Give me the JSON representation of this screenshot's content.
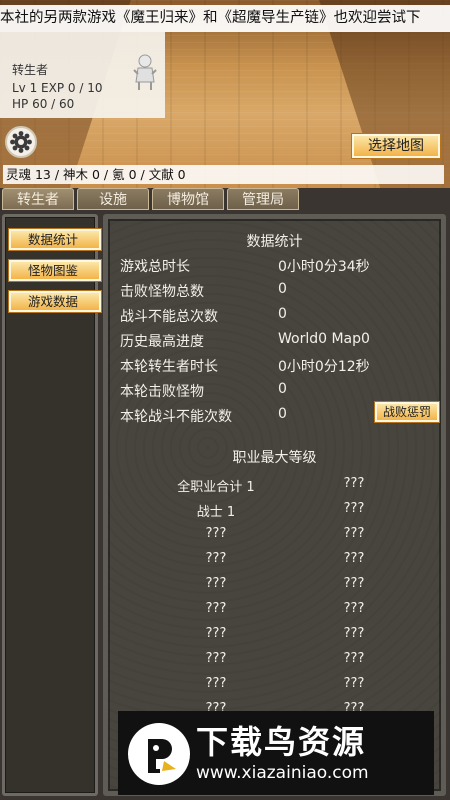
{
  "ticker": "本社的另两款游戏《魔王归来》和《超魔导生产链》也欢迎尝试下",
  "character": {
    "name": "转生者",
    "level_exp": "Lv 1 EXP 0 / 10",
    "hp": "HP 60 / 60"
  },
  "buttons": {
    "select_map": "选择地图",
    "fail_penalty": "战败惩罚"
  },
  "resources": "灵魂 13 / 神木 0 / 氪 0 / 文献 0",
  "tabs": [
    {
      "label": "转生者"
    },
    {
      "label": "设施"
    },
    {
      "label": "博物馆"
    },
    {
      "label": "管理局"
    }
  ],
  "sidebar": [
    {
      "label": "数据统计"
    },
    {
      "label": "怪物图鉴"
    },
    {
      "label": "游戏数据"
    }
  ],
  "stats": {
    "title": "数据统计",
    "rows": [
      {
        "label": "游戏总时长",
        "value": "0小时0分34秒"
      },
      {
        "label": "击败怪物总数",
        "value": "0"
      },
      {
        "label": "战斗不能总次数",
        "value": "0"
      },
      {
        "label": "历史最高进度",
        "value": "World0 Map0"
      },
      {
        "label": "本轮转生者时长",
        "value": "0小时0分12秒"
      },
      {
        "label": "本轮击败怪物",
        "value": "0"
      },
      {
        "label": "本轮战斗不能次数",
        "value": "0"
      }
    ]
  },
  "jobs": {
    "title": "职业最大等级",
    "rows": [
      {
        "name": "全职业合计 1",
        "level": "???"
      },
      {
        "name": "战士 1",
        "level": "???"
      },
      {
        "name": "???",
        "level": "???"
      },
      {
        "name": "???",
        "level": "???"
      },
      {
        "name": "???",
        "level": "???"
      },
      {
        "name": "???",
        "level": "???"
      },
      {
        "name": "???",
        "level": "???"
      },
      {
        "name": "???",
        "level": "???"
      },
      {
        "name": "???",
        "level": "???"
      },
      {
        "name": "???",
        "level": "???"
      }
    ]
  },
  "watermark": {
    "title": "下载鸟资源",
    "url": "www.xiazainiao.com"
  },
  "colors": {
    "button_gold": "#f3b349",
    "panel_bg": "#48453e",
    "tab_bg": "#7d6c52"
  }
}
